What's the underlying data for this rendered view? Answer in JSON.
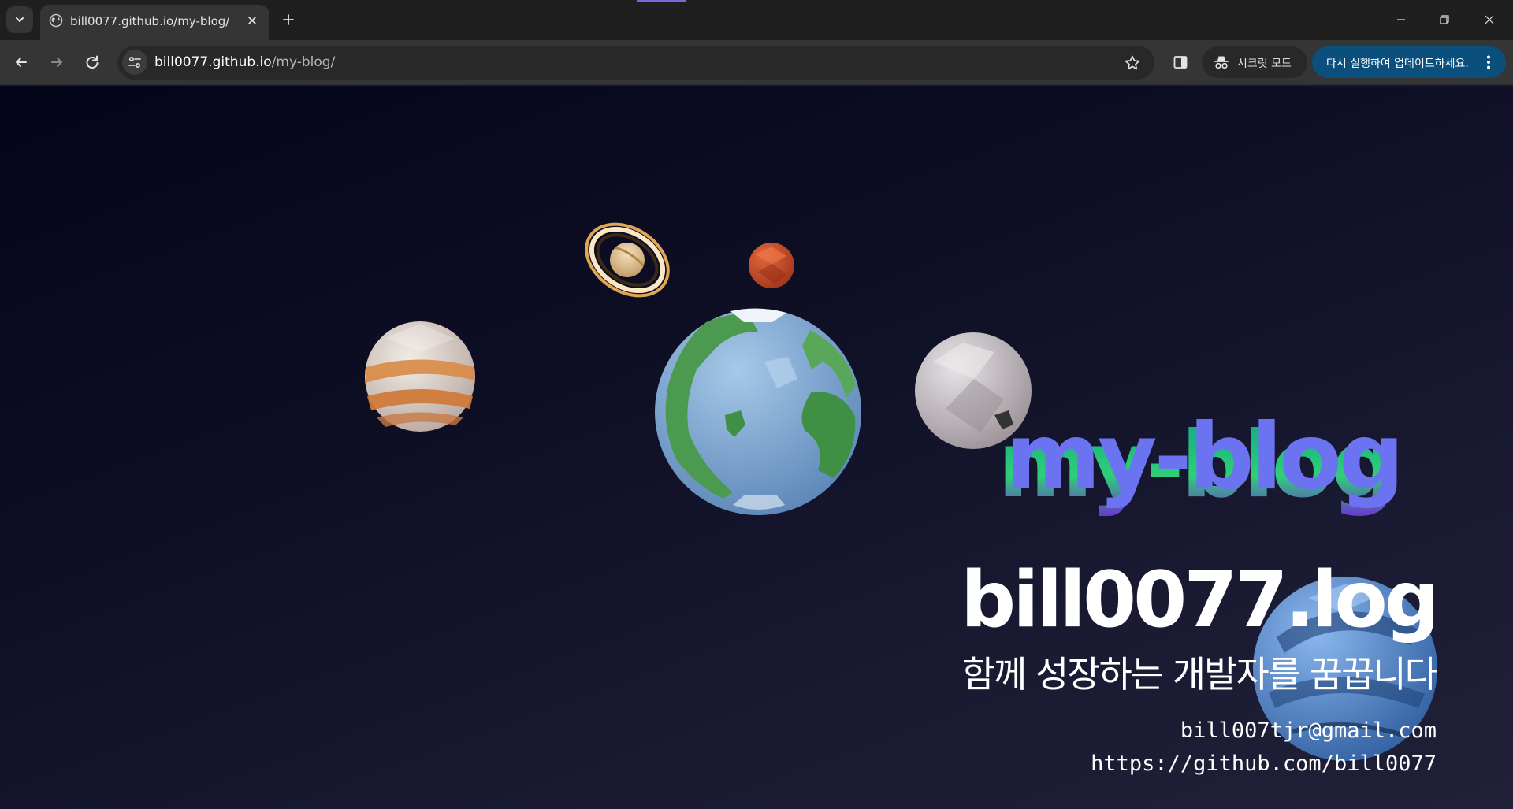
{
  "browser": {
    "tab": {
      "title": "bill0077.github.io/my-blog/"
    },
    "address_bar": {
      "host": "bill0077.github.io",
      "path": "/my-blog/"
    },
    "incognito": {
      "label": "시크릿 모드"
    },
    "update": {
      "label": "다시 실행하여 업데이트하세요."
    },
    "colors": {
      "frame": "#1f1f1f",
      "toolbar": "#353535",
      "update_chip": "#0b4f7c"
    },
    "icons": {
      "tab_menu": "chevron-down-icon",
      "favicon": "globe-icon",
      "close": "close-icon",
      "new_tab": "plus-icon",
      "back": "arrow-left-icon",
      "forward": "arrow-right-icon",
      "reload": "reload-icon",
      "site_info": "tune-icon",
      "bookmark": "star-icon",
      "side_panel": "side-panel-icon",
      "incognito": "incognito-icon",
      "menu": "kebab-menu-icon",
      "minimize": "minimize-icon",
      "restore": "restore-icon",
      "window_close": "window-close-icon"
    }
  },
  "page": {
    "logo_3d_text": "my-blog",
    "title": "bill0077.log",
    "tagline": "함께 성장하는 개발자를 꿈꿉니다",
    "email": "bill007tjr@gmail.com",
    "github": "https://github.com/bill0077",
    "colors": {
      "background_top": "#04051a",
      "background_bottom": "#202037",
      "logo_face": "#6b73f0",
      "logo_side": "#10a489"
    }
  }
}
